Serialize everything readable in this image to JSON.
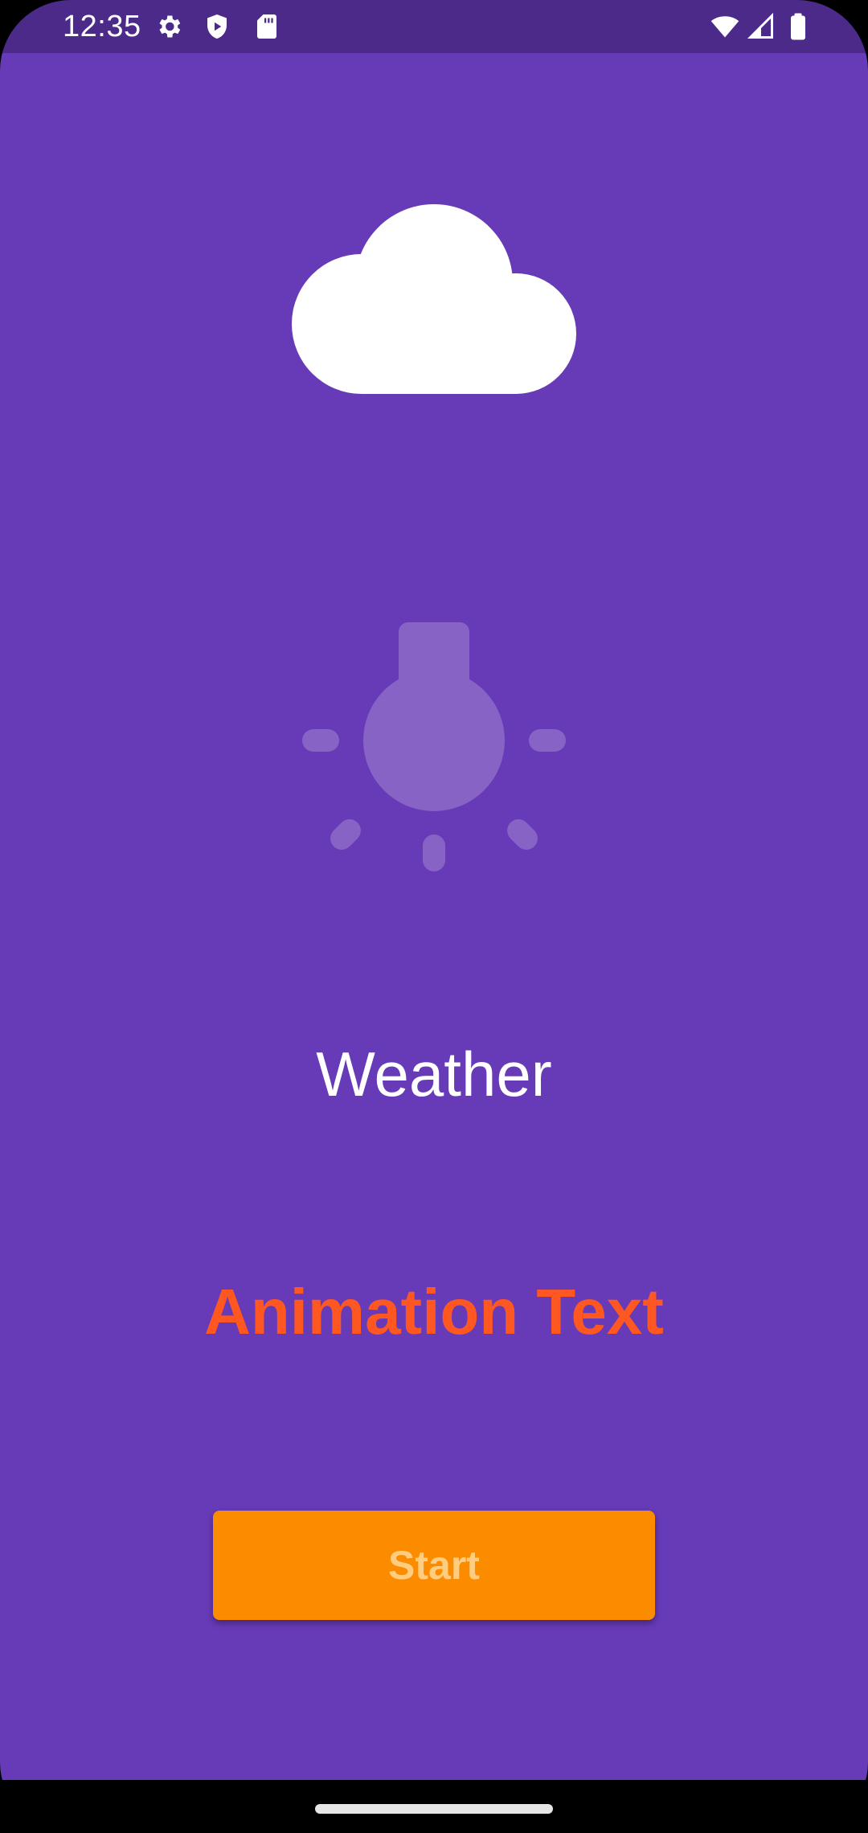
{
  "status_bar": {
    "time": "12:35",
    "left_icons": [
      "gear-icon",
      "shield-play-icon",
      "sd-card-icon"
    ],
    "right_icons": [
      "wifi-icon",
      "cellular-signal-icon",
      "battery-icon"
    ]
  },
  "app": {
    "background_color": "#673ab7",
    "cloud_icon": "cloud-icon",
    "bulb_icon": "light-bulb-icon",
    "title": "Weather",
    "animation_text": "Animation Text",
    "animation_text_color": "#ff5722",
    "start_button": {
      "label": "Start",
      "background_color": "#fb8c00"
    }
  },
  "nav_bar": {
    "handle": "home-handle"
  }
}
